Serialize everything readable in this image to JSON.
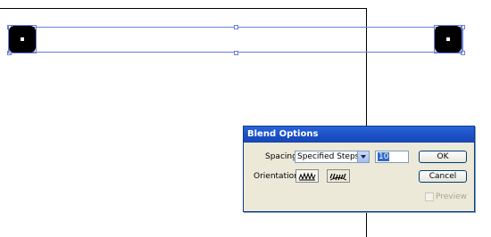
{
  "dialog": {
    "title": "Blend Options",
    "spacing_label": "Spacing:",
    "spacing_value": "Specified Steps",
    "steps_value": "10",
    "orientation_label": "Orientation:",
    "ok_label": "OK",
    "cancel_label": "Cancel",
    "preview_label": "Preview",
    "preview_checked": false,
    "preview_enabled": false
  },
  "colors": {
    "selection": "#6b7fd6",
    "titlebar": "#1a4fc4",
    "dialog_bg": "#ece9d8"
  },
  "icons": {
    "orientation_align_page": "align-to-page-icon",
    "orientation_align_path": "align-to-path-icon"
  }
}
